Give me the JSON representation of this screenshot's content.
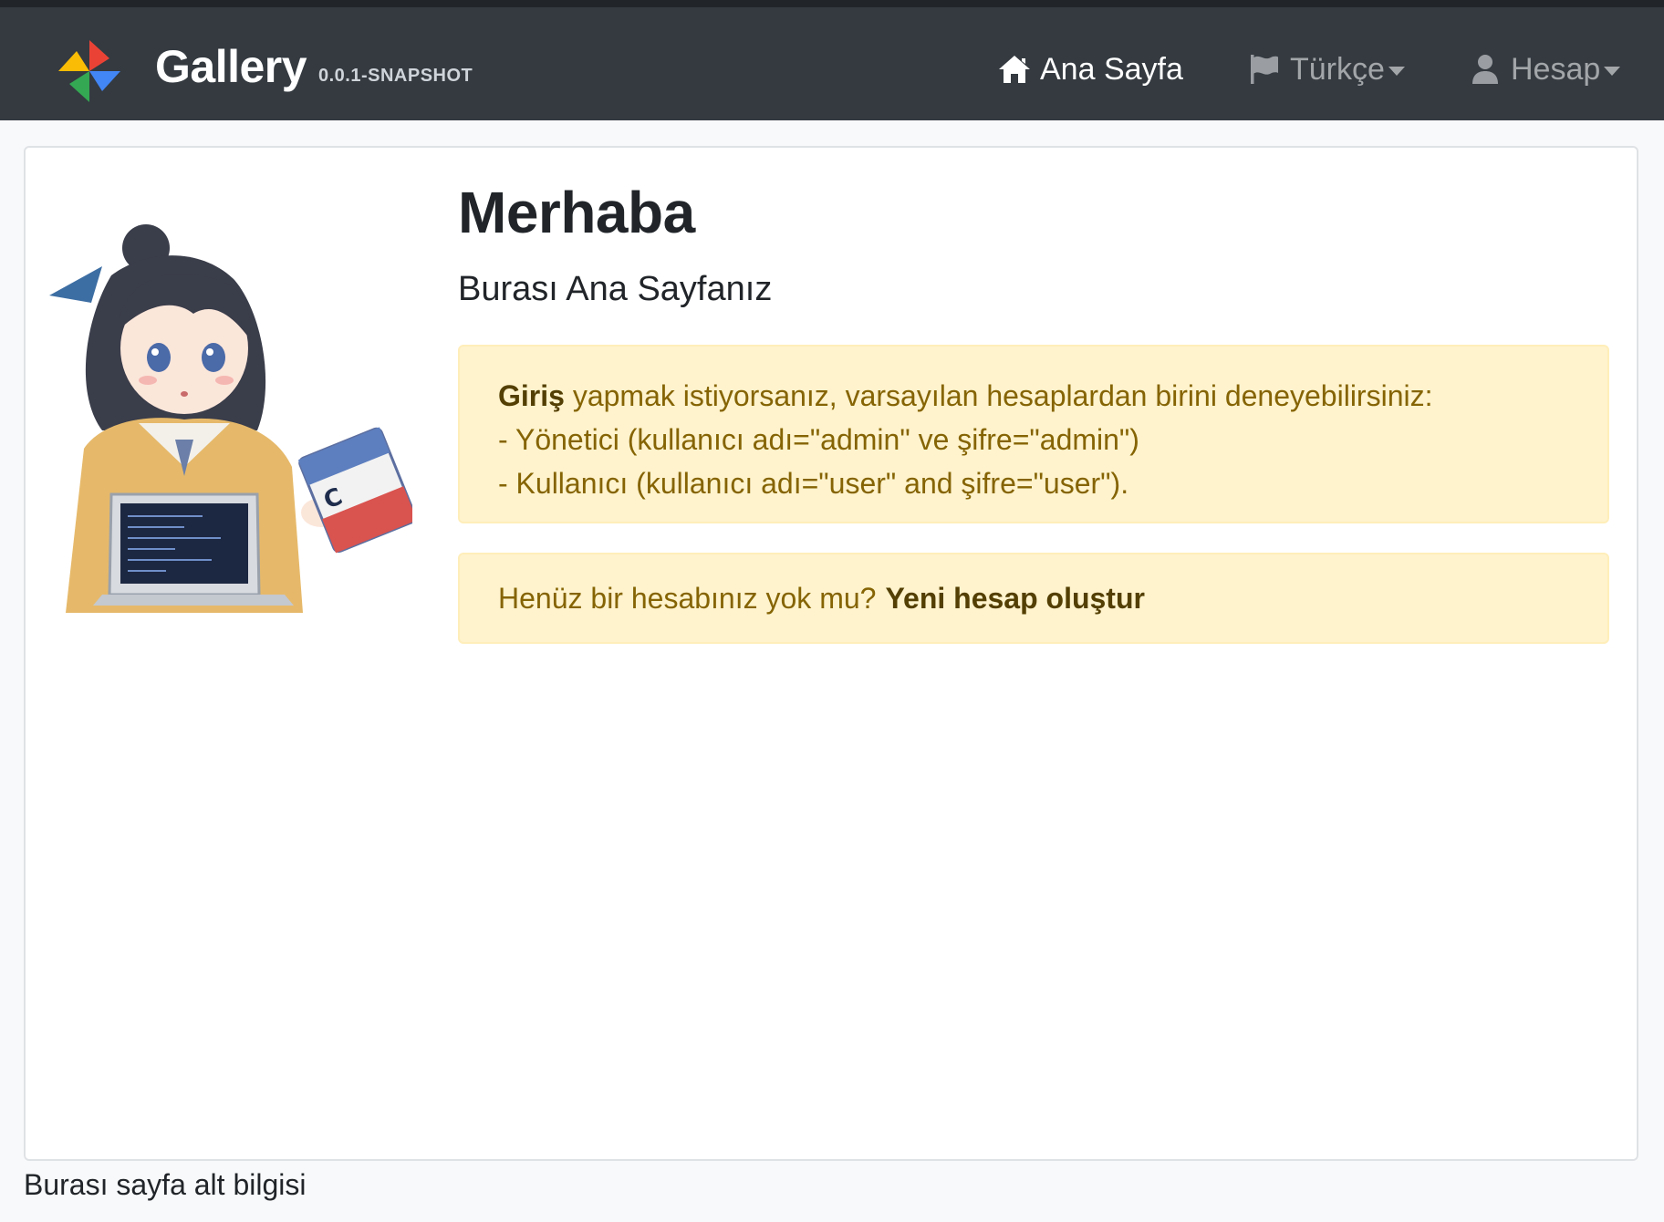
{
  "brand": {
    "name": "Gallery",
    "version": "0.0.1-SNAPSHOT",
    "logo_icon": "pinwheel-logo-icon"
  },
  "nav": {
    "home": {
      "label": "Ana Sayfa",
      "icon": "home-icon"
    },
    "language": {
      "label": "Türkçe",
      "icon": "flag-icon"
    },
    "account": {
      "label": "Hesap",
      "icon": "user-icon"
    }
  },
  "main": {
    "title": "Merhaba",
    "subtitle": "Burası Ana Sayfanız",
    "login_alert": {
      "strong": "Giriş",
      "intro": " yapmak istiyorsanız, varsayılan hesaplardan birini deneyebilirsiniz:",
      "line_admin": "- Yönetici (kullanıcı adı=\"admin\" ve şifre=\"admin\")",
      "line_user": "- Kullanıcı (kullanıcı adı=\"user\" and şifre=\"user\")."
    },
    "register_alert": {
      "text": "Henüz bir hesabınız yok mu?",
      "link": "Yeni hesap oluştur"
    }
  },
  "footer": {
    "text": "Burası sayfa alt bilgisi"
  },
  "colors": {
    "navbar": "#343a40",
    "alert_bg": "#fff3cd",
    "alert_text": "#856404",
    "alert_strong": "#533f03"
  }
}
